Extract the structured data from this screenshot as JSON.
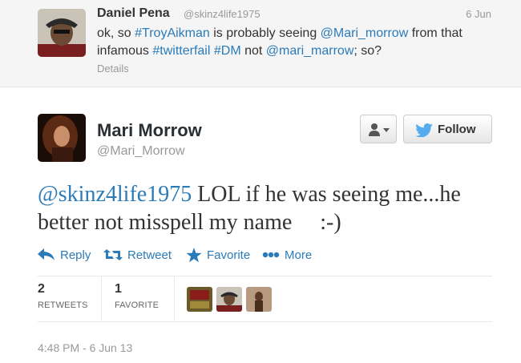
{
  "reply": {
    "name": "Daniel Pena",
    "handle": "@skinz4life1975",
    "date": "6 Jun",
    "text_parts": [
      {
        "t": "text",
        "v": "ok, so "
      },
      {
        "t": "link",
        "v": "#TroyAikman"
      },
      {
        "t": "text",
        "v": " is probably seeing "
      },
      {
        "t": "link",
        "v": "@Mari_morrow"
      },
      {
        "t": "text",
        "v": " from that infamous "
      },
      {
        "t": "link",
        "v": "#twitterfail"
      },
      {
        "t": "text",
        "v": " "
      },
      {
        "t": "link",
        "v": "#DM"
      },
      {
        "t": "text",
        "v": " not "
      },
      {
        "t": "link",
        "v": "@mari_marrow"
      },
      {
        "t": "text",
        "v": "; so?"
      }
    ],
    "details_label": "Details"
  },
  "tweet": {
    "name": "Mari Morrow",
    "handle": "@Mari_Morrow",
    "mention": "@skinz4life1975",
    "text": " LOL if he was seeing me...he better not misspell my name     :-)",
    "follow_label": "Follow",
    "actions": {
      "reply": "Reply",
      "retweet": "Retweet",
      "favorite": "Favorite",
      "more": "More"
    },
    "stats": {
      "retweets_count": "2",
      "retweets_label": "RETWEETS",
      "favorites_count": "1",
      "favorites_label": "FAVORITE"
    },
    "timestamp": "4:48 PM - 6 Jun 13"
  },
  "colors": {
    "link": "#2b7bb9",
    "twitter_blue": "#55acee",
    "muted": "#999999"
  }
}
